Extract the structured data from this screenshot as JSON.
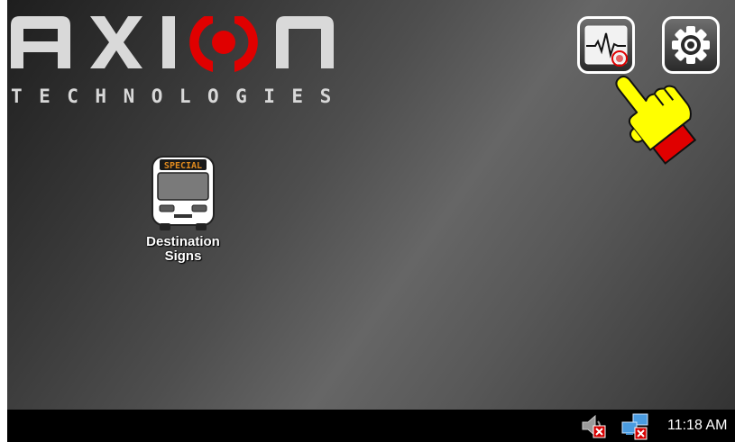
{
  "logo": {
    "brand_name": "AXION TECHNOLOGIES",
    "subtitle": "TECHNOLOGIES",
    "accent_color": "#e00000"
  },
  "toolbar": {
    "diagnostics_icon": "heartbeat-monitor-icon",
    "settings_icon": "gear-icon"
  },
  "pointer": {
    "icon": "pointing-hand-icon",
    "color": "#ffff00",
    "cuff_color": "#e00000"
  },
  "desktop": {
    "apps": [
      {
        "label": "Destination\nSigns",
        "icon": "bus-icon",
        "sign_text": "SPECIAL",
        "sign_color": "#e08a1e"
      }
    ]
  },
  "taskbar": {
    "tray": [
      {
        "icon": "speaker-muted-icon"
      },
      {
        "icon": "network-disconnected-icon"
      }
    ],
    "clock": "11:18 AM"
  }
}
